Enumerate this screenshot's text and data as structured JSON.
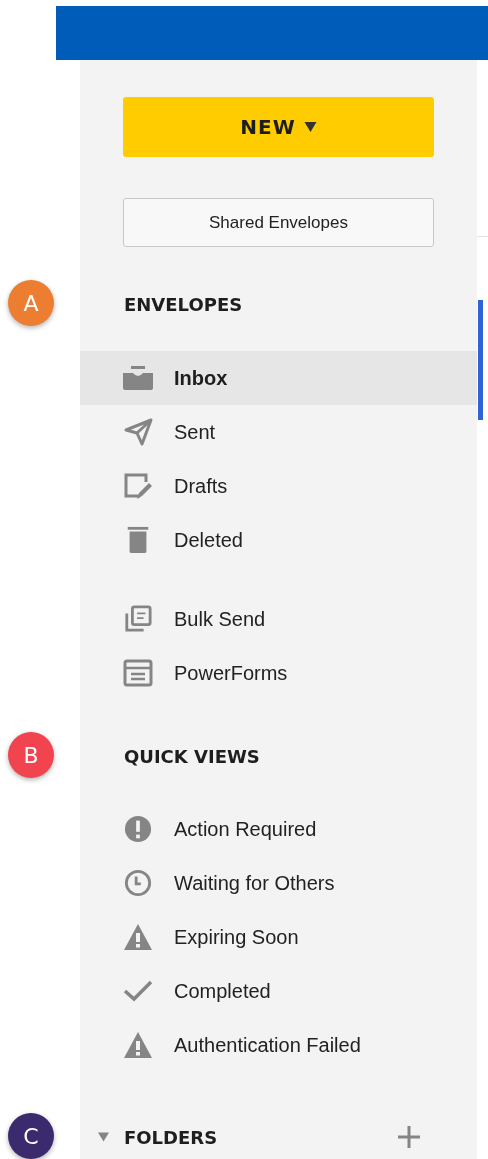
{
  "new_button": {
    "label": "NEW"
  },
  "shared_button": {
    "label": "Shared Envelopes"
  },
  "envelopes": {
    "heading": "ENVELOPES",
    "marker": {
      "label": "A",
      "color": "#ed7d31"
    },
    "groups": [
      [
        {
          "label": "Inbox",
          "selected": true
        },
        {
          "label": "Sent",
          "selected": false
        },
        {
          "label": "Drafts",
          "selected": false
        },
        {
          "label": "Deleted",
          "selected": false
        }
      ],
      [
        {
          "label": "Bulk Send",
          "selected": false
        },
        {
          "label": "PowerForms",
          "selected": false
        }
      ]
    ]
  },
  "quick_views": {
    "heading": "QUICK VIEWS",
    "marker": {
      "label": "B",
      "color": "#f2444f"
    },
    "items": [
      {
        "label": "Action Required",
        "selected": false
      },
      {
        "label": "Waiting for Others",
        "selected": false
      },
      {
        "label": "Expiring Soon",
        "selected": false
      },
      {
        "label": "Completed",
        "selected": false
      },
      {
        "label": "Authentication Failed",
        "selected": false
      }
    ]
  },
  "folders": {
    "heading": "FOLDERS",
    "expanded": true,
    "marker": {
      "label": "C",
      "color": "#3b2a6e"
    }
  }
}
